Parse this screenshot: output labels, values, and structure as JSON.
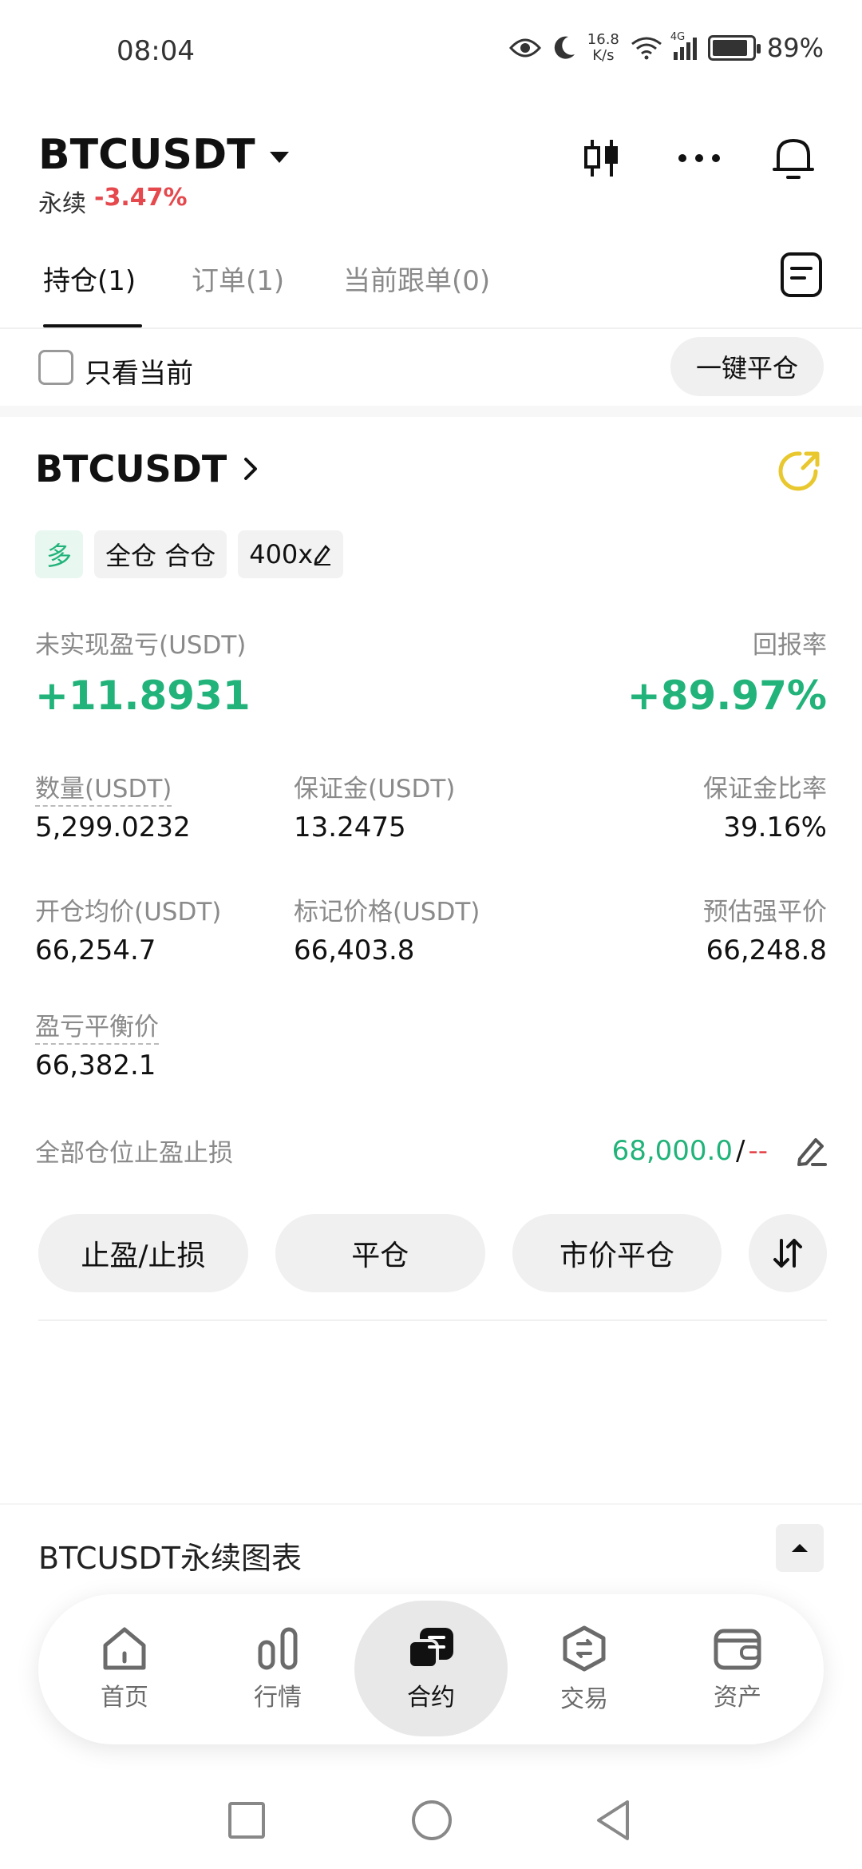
{
  "status": {
    "time": "08:04",
    "net_speed_top": "16.8",
    "net_speed_bottom": "K/s",
    "battery": "89%",
    "signal": "4G"
  },
  "header": {
    "symbol": "BTCUSDT",
    "type": "永续",
    "change": "-3.47%"
  },
  "tabs": [
    {
      "label": "持仓(1)"
    },
    {
      "label": "订单(1)"
    },
    {
      "label": "当前跟单(0)"
    }
  ],
  "filter": {
    "only_current_label": "只看当前",
    "close_all_label": "一键平仓"
  },
  "position": {
    "symbol": "BTCUSDT",
    "side": "多",
    "margin_mode": "全仓 合仓",
    "leverage": "400x",
    "unrealized_label": "未实现盈亏(USDT)",
    "unrealized_value": "+11.8931",
    "roe_label": "回报率",
    "roe_value": "+89.97%",
    "qty_label": "数量(USDT)",
    "qty_value": "5,299.0232",
    "margin_label": "保证金(USDT)",
    "margin_value": "13.2475",
    "margin_ratio_label": "保证金比率",
    "margin_ratio_value": "39.16%",
    "entry_label": "开仓均价(USDT)",
    "entry_value": "66,254.7",
    "mark_label": "标记价格(USDT)",
    "mark_value": "66,403.8",
    "liq_label": "预估强平价",
    "liq_value": "66,248.8",
    "breakeven_label": "盈亏平衡价",
    "breakeven_value": "66,382.1",
    "tpsl_label": "全部仓位止盈止损",
    "tp_value": "68,000.0",
    "tpsl_slash": "/",
    "sl_value": "--"
  },
  "actions": {
    "tpsl": "止盈/止损",
    "close": "平仓",
    "market_close": "市价平仓"
  },
  "chart_bar": {
    "title": "BTCUSDT永续图表"
  },
  "nav": [
    {
      "label": "首页",
      "icon": "home-icon"
    },
    {
      "label": "行情",
      "icon": "market-icon"
    },
    {
      "label": "合约",
      "icon": "futures-icon"
    },
    {
      "label": "交易",
      "icon": "trade-icon"
    },
    {
      "label": "资产",
      "icon": "wallet-icon"
    }
  ],
  "colors": {
    "positive": "#21b37a",
    "negative": "#e5484d",
    "accent_yellow": "#e8c82e"
  }
}
